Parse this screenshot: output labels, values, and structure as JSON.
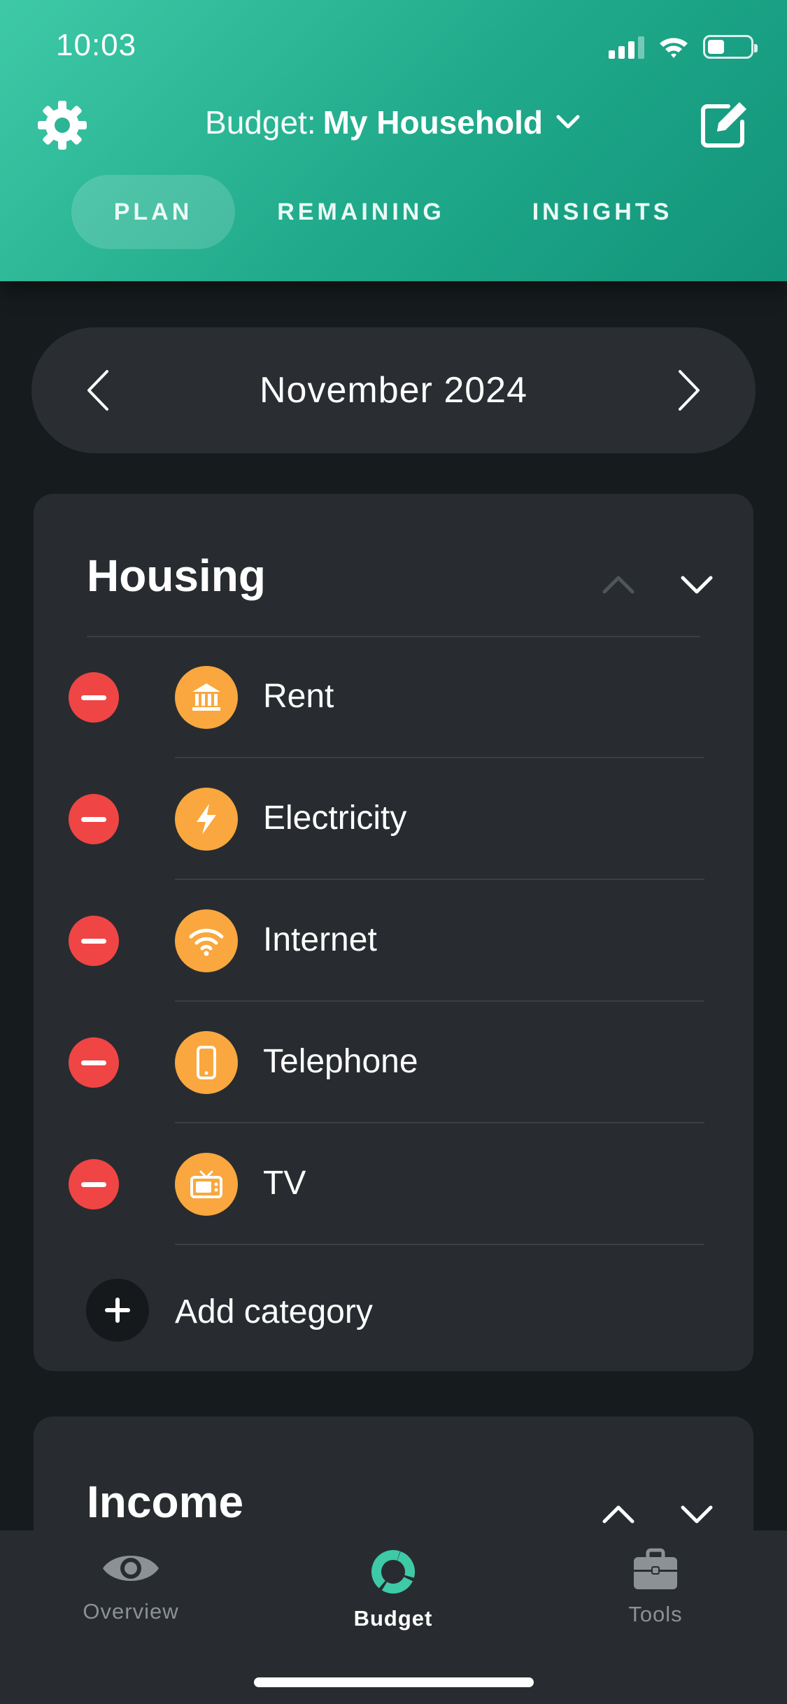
{
  "status_bar": {
    "time": "10:03",
    "battery_level": 0.4
  },
  "header": {
    "budget_prefix": "Budget:",
    "budget_name": "My Household",
    "tabs": [
      {
        "label": "PLAN",
        "active": true
      },
      {
        "label": "REMAINING",
        "active": false
      },
      {
        "label": "INSIGHTS",
        "active": false
      }
    ]
  },
  "month_selector": {
    "label": "November 2024"
  },
  "housing": {
    "title": "Housing",
    "categories": [
      {
        "label": "Rent",
        "icon": "bank-icon"
      },
      {
        "label": "Electricity",
        "icon": "lightning-icon"
      },
      {
        "label": "Internet",
        "icon": "wifi-icon"
      },
      {
        "label": "Telephone",
        "icon": "phone-icon"
      },
      {
        "label": "TV",
        "icon": "tv-icon"
      }
    ],
    "add_label": "Add category"
  },
  "income": {
    "title": "Income"
  },
  "bottom_nav": {
    "items": [
      {
        "label": "Overview",
        "icon": "eye-icon",
        "active": false
      },
      {
        "label": "Budget",
        "icon": "budget-ring-icon",
        "active": true
      },
      {
        "label": "Tools",
        "icon": "briefcase-icon",
        "active": false
      }
    ]
  },
  "colors": {
    "header_gradient_start": "#3ec9a7",
    "header_gradient_end": "#12937a",
    "remove": "#f04545",
    "category_icon_bg": "#f9a73e",
    "budget_accent": "#3ec9a7",
    "background": "#161b1d",
    "card": "#282c30"
  }
}
